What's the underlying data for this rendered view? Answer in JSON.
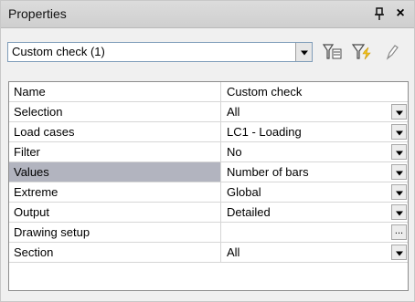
{
  "panel": {
    "title": "Properties",
    "pin_glyph": "ᴪ",
    "close_glyph": "×"
  },
  "toolbar": {
    "selector_value": "Custom check (1)",
    "icons": [
      "add-filter-icon",
      "apply-filter-icon",
      "edit-icon"
    ]
  },
  "properties": [
    {
      "name": "Name",
      "value": "Custom check",
      "control": "none"
    },
    {
      "name": "Selection",
      "value": "All",
      "control": "dropdown"
    },
    {
      "name": "Load cases",
      "value": "LC1 - Loading",
      "control": "dropdown"
    },
    {
      "name": "Filter",
      "value": "No",
      "control": "dropdown"
    },
    {
      "name": "Values",
      "value": "Number of bars",
      "control": "dropdown",
      "selected": true
    },
    {
      "name": "Extreme",
      "value": "Global",
      "control": "dropdown"
    },
    {
      "name": "Output",
      "value": "Detailed",
      "control": "dropdown"
    },
    {
      "name": "Drawing setup",
      "value": "",
      "control": "ellipsis",
      "button_label": "..."
    },
    {
      "name": "Section",
      "value": "All",
      "control": "dropdown"
    }
  ],
  "colors": {
    "selected_row": "#b2b4bf",
    "title_bar": "#d4d4d4"
  }
}
